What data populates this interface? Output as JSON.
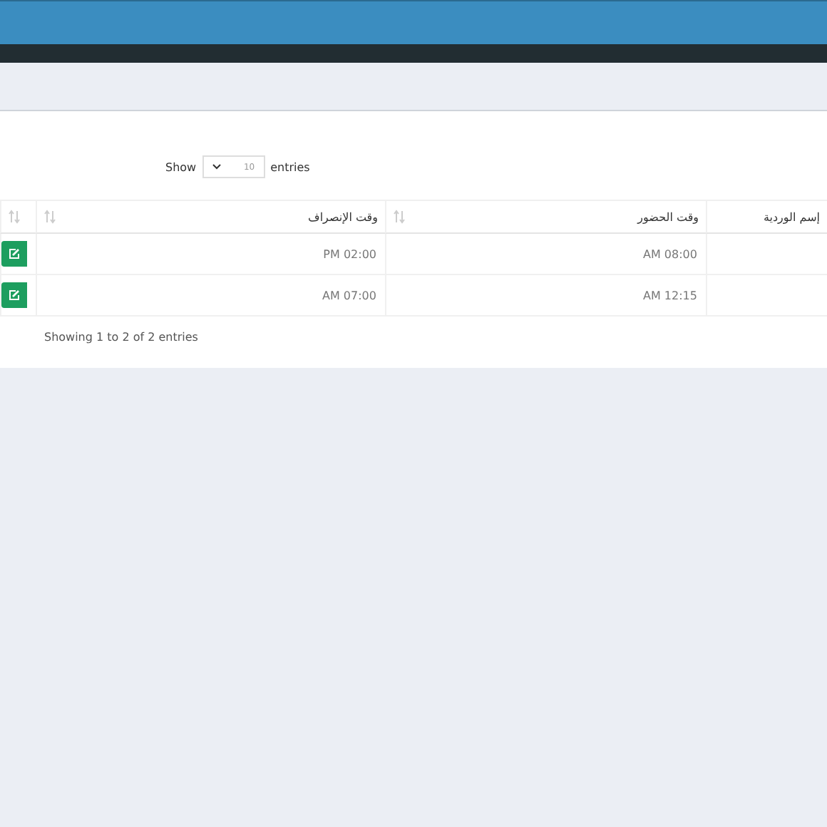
{
  "length_menu": {
    "label_before": "Show",
    "value": "10",
    "label_after": "entries"
  },
  "table": {
    "columns": [
      "إسم الوردية",
      "وقت الحضور",
      "وقت الإنصراف",
      ""
    ],
    "rows": [
      {
        "start": "AM 08:00",
        "end": "PM 02:00"
      },
      {
        "start": "AM 12:15",
        "end": "AM 07:00"
      }
    ]
  },
  "info": "Showing 1 to 2 of 2 entries"
}
